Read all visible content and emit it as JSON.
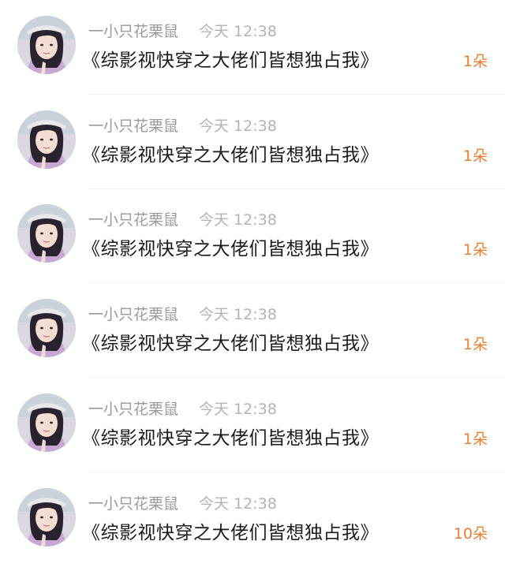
{
  "gift_list": {
    "items": [
      {
        "name": "一小只花栗鼠",
        "time": "今天 12:38",
        "title": "《综影视快穿之大佬们皆想独占我》",
        "count": "1朵"
      },
      {
        "name": "一小只花栗鼠",
        "time": "今天 12:38",
        "title": "《综影视快穿之大佬们皆想独占我》",
        "count": "1朵"
      },
      {
        "name": "一小只花栗鼠",
        "time": "今天 12:38",
        "title": "《综影视快穿之大佬们皆想独占我》",
        "count": "1朵"
      },
      {
        "name": "一小只花栗鼠",
        "time": "今天 12:38",
        "title": "《综影视快穿之大佬们皆想独占我》",
        "count": "1朵"
      },
      {
        "name": "一小只花栗鼠",
        "time": "今天 12:38",
        "title": "《综影视快穿之大佬们皆想独占我》",
        "count": "1朵"
      },
      {
        "name": "一小只花栗鼠",
        "time": "今天 12:38",
        "title": "《综影视快穿之大佬们皆想独占我》",
        "count": "10朵"
      }
    ]
  },
  "colors": {
    "accent": "#ee7d31",
    "name": "#9a9a9a",
    "time": "#b4b4b4",
    "title": "#1c1c1c"
  }
}
